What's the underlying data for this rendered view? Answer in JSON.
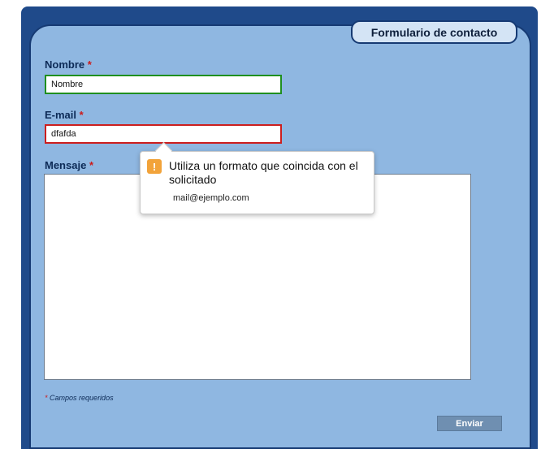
{
  "form": {
    "title": "Formulario de contacto",
    "fields": {
      "name": {
        "label": "Nombre",
        "required_mark": "*",
        "value": "Nombre"
      },
      "email": {
        "label": "E-mail",
        "required_mark": "*",
        "value": "dfafda"
      },
      "message": {
        "label": "Mensaje",
        "required_mark": "*",
        "value": ""
      }
    },
    "required_note": {
      "mark": "*",
      "text": "Campos requeridos"
    },
    "submit_label": "Enviar"
  },
  "validation_tooltip": {
    "icon": "warning-icon",
    "icon_glyph": "!",
    "message": "Utiliza un formato que coincida con el solicitado",
    "hint": "mail@ejemplo.com"
  },
  "colors": {
    "frame": "#1f4a8a",
    "panel": "#8fb7e1",
    "label": "#0d2b57",
    "required": "#cc1a1a",
    "valid_border": "#1f8f1f",
    "invalid_border": "#cc1e1e",
    "button": "#6f8fb1",
    "warning": "#f2a33a"
  }
}
